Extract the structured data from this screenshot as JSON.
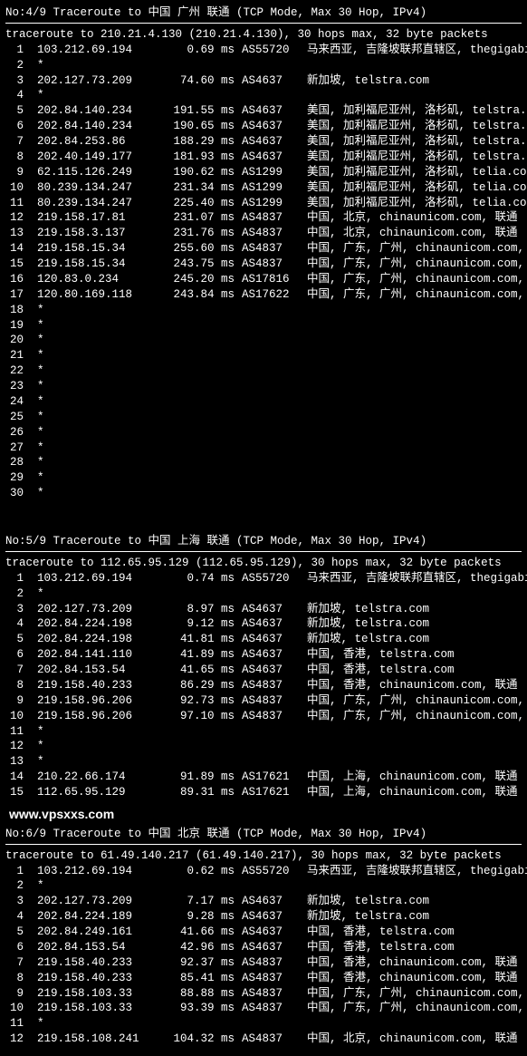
{
  "watermark": "www.vpsxxs.com",
  "blocks": [
    {
      "header": "No:4/9 Traceroute to 中国 广州 联通 (TCP Mode, Max 30 Hop, IPv4)",
      "subheader": "traceroute to 210.21.4.130 (210.21.4.130), 30 hops max, 32 byte packets",
      "hops": [
        {
          "n": 1,
          "ip": "103.212.69.194",
          "ms": "0.69 ms",
          "as": "AS55720",
          "loc": "马来西亚, 吉隆坡联邦直辖区, thegigabit.com"
        },
        {
          "n": 2,
          "ip": "*"
        },
        {
          "n": 3,
          "ip": "202.127.73.209",
          "ms": "74.60 ms",
          "as": "AS4637",
          "loc": "新加坡, telstra.com"
        },
        {
          "n": 4,
          "ip": "*"
        },
        {
          "n": 5,
          "ip": "202.84.140.234",
          "ms": "191.55 ms",
          "as": "AS4637",
          "loc": "美国, 加利福尼亚州, 洛杉矶, telstra.com"
        },
        {
          "n": 6,
          "ip": "202.84.140.234",
          "ms": "190.65 ms",
          "as": "AS4637",
          "loc": "美国, 加利福尼亚州, 洛杉矶, telstra.com"
        },
        {
          "n": 7,
          "ip": "202.84.253.86",
          "ms": "188.29 ms",
          "as": "AS4637",
          "loc": "美国, 加利福尼亚州, 洛杉矶, telstra.com"
        },
        {
          "n": 8,
          "ip": "202.40.149.177",
          "ms": "181.93 ms",
          "as": "AS4637",
          "loc": "美国, 加利福尼亚州, 洛杉矶, telstra.com"
        },
        {
          "n": 9,
          "ip": "62.115.126.249",
          "ms": "190.62 ms",
          "as": "AS1299",
          "loc": "美国, 加利福尼亚州, 洛杉矶, telia.com"
        },
        {
          "n": 10,
          "ip": "80.239.134.247",
          "ms": "231.34 ms",
          "as": "AS1299",
          "loc": "美国, 加利福尼亚州, 洛杉矶, telia.com"
        },
        {
          "n": 11,
          "ip": "80.239.134.247",
          "ms": "225.40 ms",
          "as": "AS1299",
          "loc": "美国, 加利福尼亚州, 洛杉矶, telia.com"
        },
        {
          "n": 12,
          "ip": "219.158.17.81",
          "ms": "231.07 ms",
          "as": "AS4837",
          "loc": "中国, 北京, chinaunicom.com, 联通"
        },
        {
          "n": 13,
          "ip": "219.158.3.137",
          "ms": "231.76 ms",
          "as": "AS4837",
          "loc": "中国, 北京, chinaunicom.com, 联通"
        },
        {
          "n": 14,
          "ip": "219.158.15.34",
          "ms": "255.60 ms",
          "as": "AS4837",
          "loc": "中国, 广东, 广州, chinaunicom.com, 联通"
        },
        {
          "n": 15,
          "ip": "219.158.15.34",
          "ms": "243.75 ms",
          "as": "AS4837",
          "loc": "中国, 广东, 广州, chinaunicom.com, 联通"
        },
        {
          "n": 16,
          "ip": "120.83.0.234",
          "ms": "245.20 ms",
          "as": "AS17816",
          "loc": "中国, 广东, 广州, chinaunicom.com, 联通"
        },
        {
          "n": 17,
          "ip": "120.80.169.118",
          "ms": "243.84 ms",
          "as": "AS17622",
          "loc": "中国, 广东, 广州, chinaunicom.com, 联通"
        },
        {
          "n": 18,
          "ip": "*"
        },
        {
          "n": 19,
          "ip": "*"
        },
        {
          "n": 20,
          "ip": "*"
        },
        {
          "n": 21,
          "ip": "*"
        },
        {
          "n": 22,
          "ip": "*"
        },
        {
          "n": 23,
          "ip": "*"
        },
        {
          "n": 24,
          "ip": "*"
        },
        {
          "n": 25,
          "ip": "*"
        },
        {
          "n": 26,
          "ip": "*"
        },
        {
          "n": 27,
          "ip": "*"
        },
        {
          "n": 28,
          "ip": "*"
        },
        {
          "n": 29,
          "ip": "*"
        },
        {
          "n": 30,
          "ip": "*"
        }
      ]
    },
    {
      "header": "No:5/9 Traceroute to 中国 上海 联通 (TCP Mode, Max 30 Hop, IPv4)",
      "subheader": "traceroute to 112.65.95.129 (112.65.95.129), 30 hops max, 32 byte packets",
      "hops": [
        {
          "n": 1,
          "ip": "103.212.69.194",
          "ms": "0.74 ms",
          "as": "AS55720",
          "loc": "马来西亚, 吉隆坡联邦直辖区, thegigabit.com"
        },
        {
          "n": 2,
          "ip": "*"
        },
        {
          "n": 3,
          "ip": "202.127.73.209",
          "ms": "8.97 ms",
          "as": "AS4637",
          "loc": "新加坡, telstra.com"
        },
        {
          "n": 4,
          "ip": "202.84.224.198",
          "ms": "9.12 ms",
          "as": "AS4637",
          "loc": "新加坡, telstra.com"
        },
        {
          "n": 5,
          "ip": "202.84.224.198",
          "ms": "41.81 ms",
          "as": "AS4637",
          "loc": "新加坡, telstra.com"
        },
        {
          "n": 6,
          "ip": "202.84.141.110",
          "ms": "41.89 ms",
          "as": "AS4637",
          "loc": "中国, 香港, telstra.com"
        },
        {
          "n": 7,
          "ip": "202.84.153.54",
          "ms": "41.65 ms",
          "as": "AS4637",
          "loc": "中国, 香港, telstra.com"
        },
        {
          "n": 8,
          "ip": "219.158.40.233",
          "ms": "86.29 ms",
          "as": "AS4837",
          "loc": "中国, 香港, chinaunicom.com, 联通"
        },
        {
          "n": 9,
          "ip": "219.158.96.206",
          "ms": "92.73 ms",
          "as": "AS4837",
          "loc": "中国, 广东, 广州, chinaunicom.com, 联通"
        },
        {
          "n": 10,
          "ip": "219.158.96.206",
          "ms": "97.10 ms",
          "as": "AS4837",
          "loc": "中国, 广东, 广州, chinaunicom.com, 联通"
        },
        {
          "n": 11,
          "ip": "*"
        },
        {
          "n": 12,
          "ip": "*"
        },
        {
          "n": 13,
          "ip": "*"
        },
        {
          "n": 14,
          "ip": "210.22.66.174",
          "ms": "91.89 ms",
          "as": "AS17621",
          "loc": "中国, 上海, chinaunicom.com, 联通"
        },
        {
          "n": 15,
          "ip": "112.65.95.129",
          "ms": "89.31 ms",
          "as": "AS17621",
          "loc": "中国, 上海, chinaunicom.com, 联通"
        }
      ]
    },
    {
      "header": "No:6/9 Traceroute to 中国 北京 联通 (TCP Mode, Max 30 Hop, IPv4)",
      "subheader": "traceroute to 61.49.140.217 (61.49.140.217), 30 hops max, 32 byte packets",
      "hops": [
        {
          "n": 1,
          "ip": "103.212.69.194",
          "ms": "0.62 ms",
          "as": "AS55720",
          "loc": "马来西亚, 吉隆坡联邦直辖区, thegigabit.com"
        },
        {
          "n": 2,
          "ip": "*"
        },
        {
          "n": 3,
          "ip": "202.127.73.209",
          "ms": "7.17 ms",
          "as": "AS4637",
          "loc": "新加坡, telstra.com"
        },
        {
          "n": 4,
          "ip": "202.84.224.189",
          "ms": "9.28 ms",
          "as": "AS4637",
          "loc": "新加坡, telstra.com"
        },
        {
          "n": 5,
          "ip": "202.84.249.161",
          "ms": "41.66 ms",
          "as": "AS4637",
          "loc": "中国, 香港, telstra.com"
        },
        {
          "n": 6,
          "ip": "202.84.153.54",
          "ms": "42.96 ms",
          "as": "AS4637",
          "loc": "中国, 香港, telstra.com"
        },
        {
          "n": 7,
          "ip": "219.158.40.233",
          "ms": "92.37 ms",
          "as": "AS4837",
          "loc": "中国, 香港, chinaunicom.com, 联通"
        },
        {
          "n": 8,
          "ip": "219.158.40.233",
          "ms": "85.41 ms",
          "as": "AS4837",
          "loc": "中国, 香港, chinaunicom.com, 联通"
        },
        {
          "n": 9,
          "ip": "219.158.103.33",
          "ms": "88.88 ms",
          "as": "AS4837",
          "loc": "中国, 广东, 广州, chinaunicom.com, 联通"
        },
        {
          "n": 10,
          "ip": "219.158.103.33",
          "ms": "93.39 ms",
          "as": "AS4837",
          "loc": "中国, 广东, 广州, chinaunicom.com, 联通"
        },
        {
          "n": 11,
          "ip": "*"
        },
        {
          "n": 12,
          "ip": "219.158.108.241",
          "ms": "104.32 ms",
          "as": "AS4837",
          "loc": "中国, 北京, chinaunicom.com, 联通"
        }
      ]
    }
  ]
}
